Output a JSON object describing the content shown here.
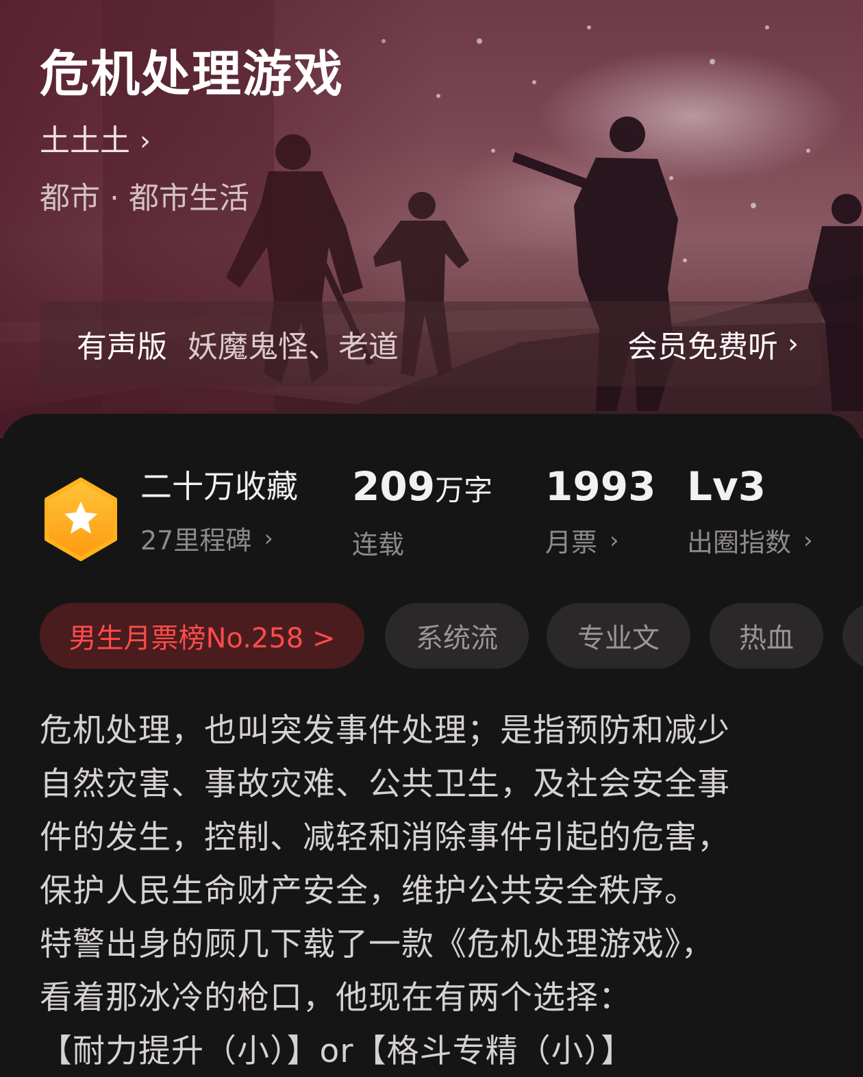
{
  "hero": {
    "title": "危机处理游戏",
    "author": "土土土",
    "genre": "都市 · 都市生活",
    "audio_label": "有声版",
    "audio_voices": "妖魔鬼怪、老道",
    "audio_cta": "会员免费听"
  },
  "stats": {
    "collect_main": "二十万收藏",
    "collect_sub": "27里程碑",
    "words_num": "209",
    "words_unit": "万字",
    "words_sub": "连载",
    "tickets_num": "1993",
    "tickets_sub": "月票",
    "level_num": "Lv3",
    "level_sub": "出圈指数"
  },
  "tags": {
    "rank": "男生月票榜No.258 >",
    "items": [
      "系统流",
      "专业文",
      "热血"
    ]
  },
  "intro": {
    "lines": [
      "危机处理，也叫突发事件处理；是指预防和减少",
      "自然灾害、事故灾难、公共卫生，及社会安全事",
      "件的发生，控制、减轻和消除事件引起的危害，",
      "保护人民生命财产安全，维护公共安全秩序。",
      "特警出身的顾几下载了一款《危机处理游戏》，",
      "看着那冰冷的枪口，他现在有两个选择：",
      "【耐力提升（小）】or【格斗专精（小）】"
    ]
  },
  "colors": {
    "accent": "#ff4b4b",
    "badge": "#ffb21c",
    "card_bg": "#161515"
  },
  "icons": {
    "badge": "star-hexagon-icon",
    "chevron": "chevron-right-icon"
  }
}
